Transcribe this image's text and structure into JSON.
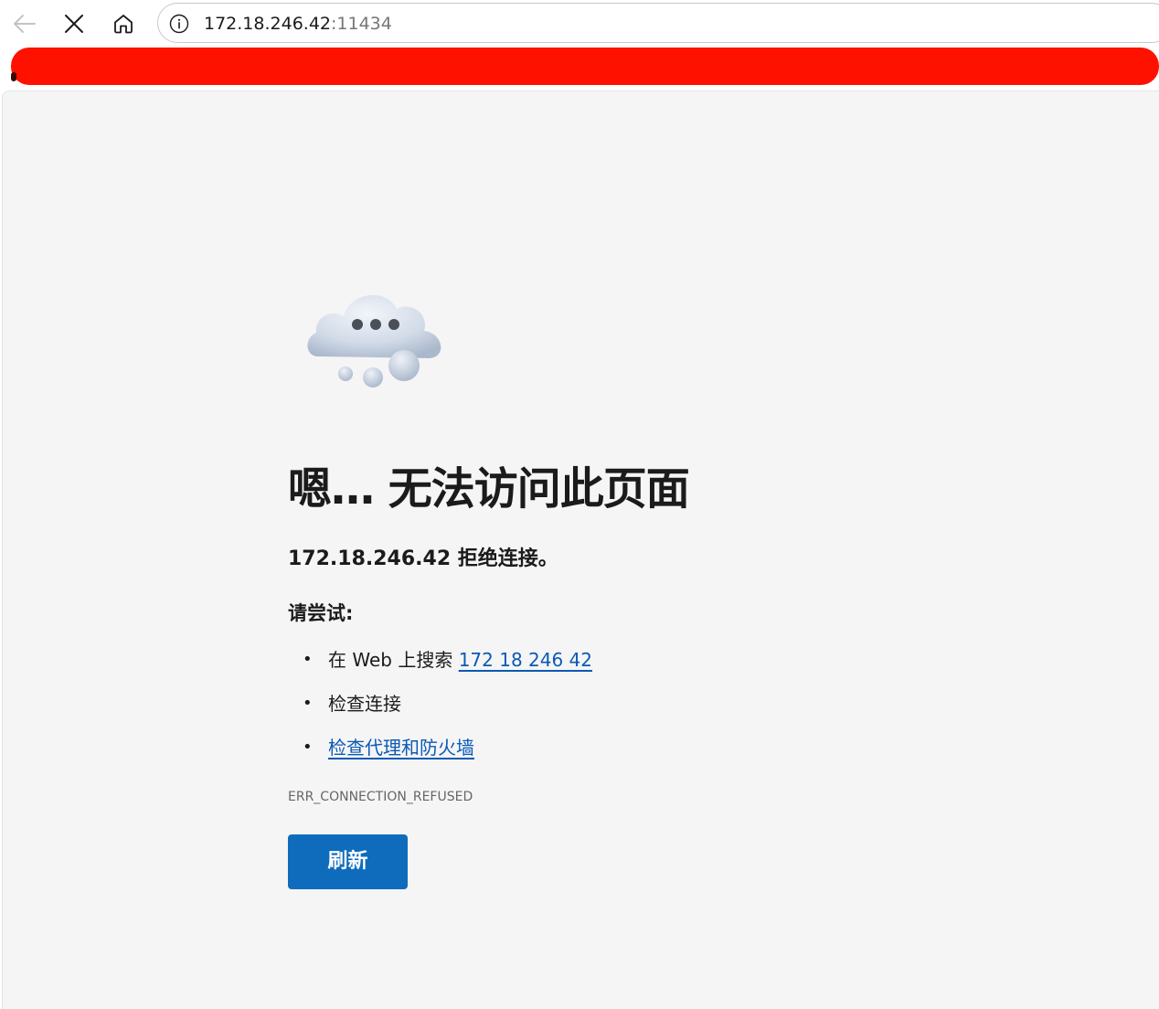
{
  "browser": {
    "url_host": "172.18.246.42",
    "url_port": ":11434",
    "icons": {
      "back": "back-arrow-icon",
      "stop": "close-icon",
      "home": "home-icon",
      "site_info": "info-icon"
    }
  },
  "error_page": {
    "title": "嗯… 无法访问此页面",
    "subtitle": "172.18.246.42 拒绝连接。",
    "try_label": "请尝试:",
    "suggestions": [
      {
        "prefix": "在 Web 上搜索 ",
        "link": "172 18 246 42"
      },
      {
        "text": "检查连接"
      },
      {
        "link": "检查代理和防火墙"
      }
    ],
    "error_code": "ERR_CONNECTION_REFUSED",
    "refresh_label": "刷新",
    "illustration": "cloud-icon"
  },
  "colors": {
    "accent": "#0f6cbd",
    "link": "#0b5ab5",
    "redaction": "#ff1100",
    "page_background": "#f5f5f5"
  }
}
